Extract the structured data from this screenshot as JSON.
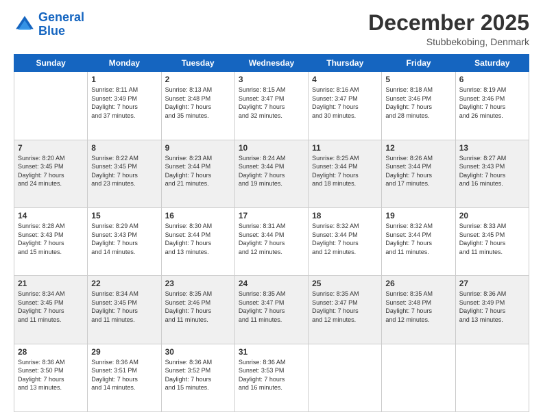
{
  "header": {
    "logo_general": "General",
    "logo_blue": "Blue",
    "month_title": "December 2025",
    "location": "Stubbekobing, Denmark"
  },
  "days_of_week": [
    "Sunday",
    "Monday",
    "Tuesday",
    "Wednesday",
    "Thursday",
    "Friday",
    "Saturday"
  ],
  "weeks": [
    [
      {
        "day": "",
        "info": ""
      },
      {
        "day": "1",
        "info": "Sunrise: 8:11 AM\nSunset: 3:49 PM\nDaylight: 7 hours\nand 37 minutes."
      },
      {
        "day": "2",
        "info": "Sunrise: 8:13 AM\nSunset: 3:48 PM\nDaylight: 7 hours\nand 35 minutes."
      },
      {
        "day": "3",
        "info": "Sunrise: 8:15 AM\nSunset: 3:47 PM\nDaylight: 7 hours\nand 32 minutes."
      },
      {
        "day": "4",
        "info": "Sunrise: 8:16 AM\nSunset: 3:47 PM\nDaylight: 7 hours\nand 30 minutes."
      },
      {
        "day": "5",
        "info": "Sunrise: 8:18 AM\nSunset: 3:46 PM\nDaylight: 7 hours\nand 28 minutes."
      },
      {
        "day": "6",
        "info": "Sunrise: 8:19 AM\nSunset: 3:46 PM\nDaylight: 7 hours\nand 26 minutes."
      }
    ],
    [
      {
        "day": "7",
        "info": "Sunrise: 8:20 AM\nSunset: 3:45 PM\nDaylight: 7 hours\nand 24 minutes."
      },
      {
        "day": "8",
        "info": "Sunrise: 8:22 AM\nSunset: 3:45 PM\nDaylight: 7 hours\nand 23 minutes."
      },
      {
        "day": "9",
        "info": "Sunrise: 8:23 AM\nSunset: 3:44 PM\nDaylight: 7 hours\nand 21 minutes."
      },
      {
        "day": "10",
        "info": "Sunrise: 8:24 AM\nSunset: 3:44 PM\nDaylight: 7 hours\nand 19 minutes."
      },
      {
        "day": "11",
        "info": "Sunrise: 8:25 AM\nSunset: 3:44 PM\nDaylight: 7 hours\nand 18 minutes."
      },
      {
        "day": "12",
        "info": "Sunrise: 8:26 AM\nSunset: 3:44 PM\nDaylight: 7 hours\nand 17 minutes."
      },
      {
        "day": "13",
        "info": "Sunrise: 8:27 AM\nSunset: 3:43 PM\nDaylight: 7 hours\nand 16 minutes."
      }
    ],
    [
      {
        "day": "14",
        "info": "Sunrise: 8:28 AM\nSunset: 3:43 PM\nDaylight: 7 hours\nand 15 minutes."
      },
      {
        "day": "15",
        "info": "Sunrise: 8:29 AM\nSunset: 3:43 PM\nDaylight: 7 hours\nand 14 minutes."
      },
      {
        "day": "16",
        "info": "Sunrise: 8:30 AM\nSunset: 3:44 PM\nDaylight: 7 hours\nand 13 minutes."
      },
      {
        "day": "17",
        "info": "Sunrise: 8:31 AM\nSunset: 3:44 PM\nDaylight: 7 hours\nand 12 minutes."
      },
      {
        "day": "18",
        "info": "Sunrise: 8:32 AM\nSunset: 3:44 PM\nDaylight: 7 hours\nand 12 minutes."
      },
      {
        "day": "19",
        "info": "Sunrise: 8:32 AM\nSunset: 3:44 PM\nDaylight: 7 hours\nand 11 minutes."
      },
      {
        "day": "20",
        "info": "Sunrise: 8:33 AM\nSunset: 3:45 PM\nDaylight: 7 hours\nand 11 minutes."
      }
    ],
    [
      {
        "day": "21",
        "info": "Sunrise: 8:34 AM\nSunset: 3:45 PM\nDaylight: 7 hours\nand 11 minutes."
      },
      {
        "day": "22",
        "info": "Sunrise: 8:34 AM\nSunset: 3:45 PM\nDaylight: 7 hours\nand 11 minutes."
      },
      {
        "day": "23",
        "info": "Sunrise: 8:35 AM\nSunset: 3:46 PM\nDaylight: 7 hours\nand 11 minutes."
      },
      {
        "day": "24",
        "info": "Sunrise: 8:35 AM\nSunset: 3:47 PM\nDaylight: 7 hours\nand 11 minutes."
      },
      {
        "day": "25",
        "info": "Sunrise: 8:35 AM\nSunset: 3:47 PM\nDaylight: 7 hours\nand 12 minutes."
      },
      {
        "day": "26",
        "info": "Sunrise: 8:35 AM\nSunset: 3:48 PM\nDaylight: 7 hours\nand 12 minutes."
      },
      {
        "day": "27",
        "info": "Sunrise: 8:36 AM\nSunset: 3:49 PM\nDaylight: 7 hours\nand 13 minutes."
      }
    ],
    [
      {
        "day": "28",
        "info": "Sunrise: 8:36 AM\nSunset: 3:50 PM\nDaylight: 7 hours\nand 13 minutes."
      },
      {
        "day": "29",
        "info": "Sunrise: 8:36 AM\nSunset: 3:51 PM\nDaylight: 7 hours\nand 14 minutes."
      },
      {
        "day": "30",
        "info": "Sunrise: 8:36 AM\nSunset: 3:52 PM\nDaylight: 7 hours\nand 15 minutes."
      },
      {
        "day": "31",
        "info": "Sunrise: 8:36 AM\nSunset: 3:53 PM\nDaylight: 7 hours\nand 16 minutes."
      },
      {
        "day": "",
        "info": ""
      },
      {
        "day": "",
        "info": ""
      },
      {
        "day": "",
        "info": ""
      }
    ]
  ]
}
